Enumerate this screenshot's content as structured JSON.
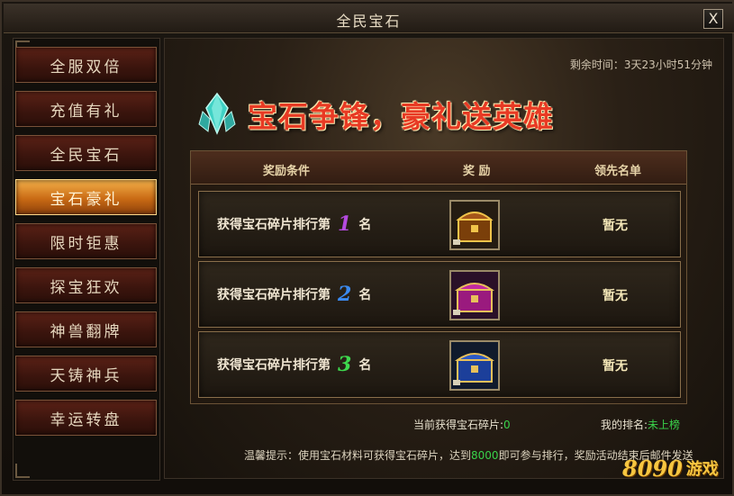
{
  "window": {
    "title": "全民宝石",
    "close_label": "X"
  },
  "sidebar": {
    "items": [
      {
        "label": "全服双倍",
        "active": false
      },
      {
        "label": "充值有礼",
        "active": false
      },
      {
        "label": "全民宝石",
        "active": false
      },
      {
        "label": "宝石豪礼",
        "active": true
      },
      {
        "label": "限时钜惠",
        "active": false
      },
      {
        "label": "探宝狂欢",
        "active": false
      },
      {
        "label": "神兽翻牌",
        "active": false
      },
      {
        "label": "天铸神兵",
        "active": false
      },
      {
        "label": "幸运转盘",
        "active": false
      }
    ]
  },
  "main": {
    "timer": "剩余时间：3天23小时51分钟",
    "banner": "宝石争锋，豪礼送英雄",
    "table": {
      "headers": [
        "奖励条件",
        "奖 励",
        "领先名单"
      ],
      "rows": [
        {
          "condition": "获得宝石碎片排行第",
          "rank": "1",
          "suffix": "名",
          "rank_color": "#b44ae0",
          "chest_color": "#7a3f0a",
          "leader": "暂无"
        },
        {
          "condition": "获得宝石碎片排行第",
          "rank": "2",
          "suffix": "名",
          "rank_color": "#3b8af0",
          "chest_color": "#9a1a7e",
          "leader": "暂无"
        },
        {
          "condition": "获得宝石碎片排行第",
          "rank": "3",
          "suffix": "名",
          "rank_color": "#3ed84e",
          "chest_color": "#1c3f9a",
          "leader": "暂无"
        }
      ]
    },
    "fragments_label": "当前获得宝石碎片:",
    "fragments_value": "0",
    "my_rank_label": "我的排名:",
    "my_rank_value": "未上榜",
    "tip_prefix": "温馨提示：使用宝石材料可获得宝石碎片，达到",
    "tip_value": "8000",
    "tip_suffix": "即可参与排行，奖励活动结束后邮件发送"
  },
  "watermark": {
    "number": "8090",
    "text": "游戏"
  }
}
